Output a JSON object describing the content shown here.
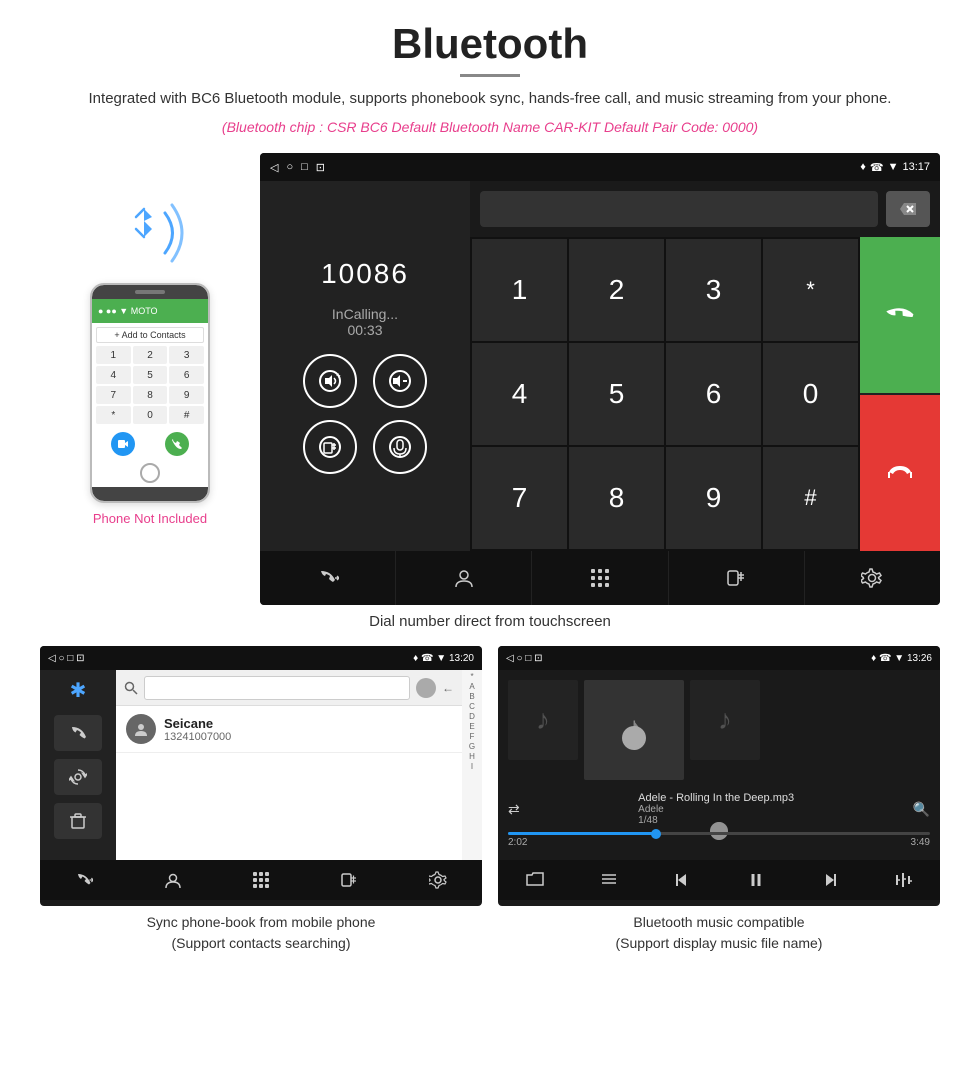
{
  "header": {
    "title": "Bluetooth",
    "description": "Integrated with BC6 Bluetooth module, supports phonebook sync, hands-free call, and music streaming from your phone.",
    "specs": "(Bluetooth chip : CSR BC6    Default Bluetooth Name CAR-KIT    Default Pair Code: 0000)"
  },
  "phone_aside": {
    "not_included": "Phone Not Included"
  },
  "main_screen": {
    "status_bar": {
      "nav_icons": "◁  ○  □  ⊡",
      "time": "13:17",
      "right_icons": "♦ ☎ ▼"
    },
    "dial": {
      "number": "10086",
      "status": "InCalling...",
      "timer": "00:33"
    },
    "numpad": [
      "1",
      "2",
      "3",
      "*",
      "4",
      "5",
      "6",
      "0",
      "7",
      "8",
      "9",
      "#"
    ],
    "caption": "Dial number direct from touchscreen"
  },
  "phonebook_screen": {
    "status_time": "13:20",
    "contact_name": "Seicane",
    "contact_number": "13241007000",
    "alpha_list": [
      "*",
      "A",
      "B",
      "C",
      "D",
      "E",
      "F",
      "G",
      "H",
      "I"
    ],
    "caption_line1": "Sync phone-book from mobile phone",
    "caption_line2": "(Support contacts searching)"
  },
  "music_screen": {
    "status_time": "13:26",
    "track_name": "Adele - Rolling In the Deep.mp3",
    "artist": "Adele",
    "track_num": "1/48",
    "time_current": "2:02",
    "time_total": "3:49",
    "caption_line1": "Bluetooth music compatible",
    "caption_line2": "(Support display music file name)"
  },
  "bottom_nav_icons": {
    "calls": "↙☎",
    "contacts": "👤",
    "dialpad": "⊞",
    "transfer": "📲",
    "settings": "⚙"
  }
}
